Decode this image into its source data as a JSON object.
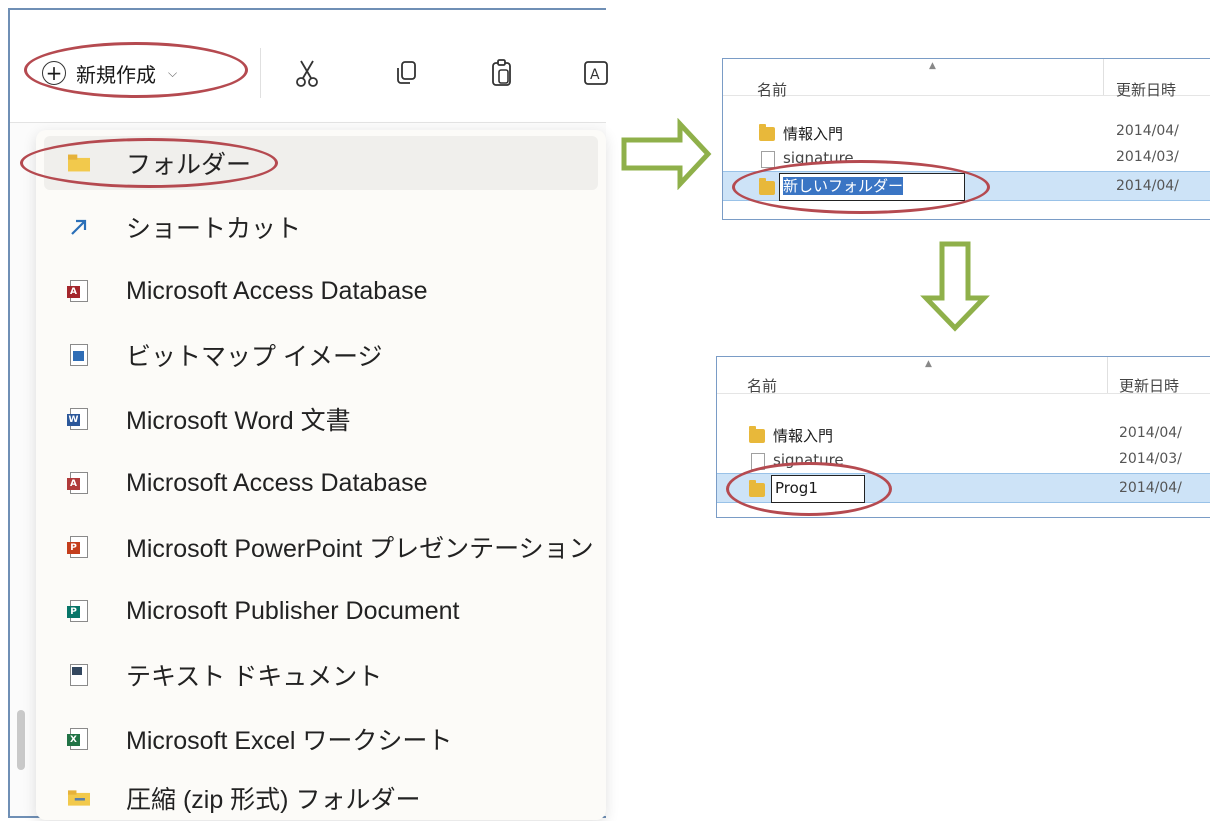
{
  "toolbar": {
    "new_label": "新規作成",
    "icons": [
      "scissors-icon",
      "copy-icon",
      "paste-icon",
      "rename-icon"
    ]
  },
  "menu": {
    "items": [
      {
        "label": "フォルダー",
        "icon": "folder-icon"
      },
      {
        "label": "ショートカット",
        "icon": "shortcut-icon"
      },
      {
        "label": "Microsoft Access Database",
        "icon": "access-icon"
      },
      {
        "label": "ビットマップ イメージ",
        "icon": "bitmap-icon"
      },
      {
        "label": "Microsoft Word 文書",
        "icon": "word-icon"
      },
      {
        "label": "Microsoft Access Database",
        "icon": "access-icon"
      },
      {
        "label": "Microsoft PowerPoint プレゼンテーション",
        "icon": "powerpoint-icon"
      },
      {
        "label": "Microsoft Publisher Document",
        "icon": "publisher-icon"
      },
      {
        "label": "テキスト ドキュメント",
        "icon": "text-document-icon"
      },
      {
        "label": "Microsoft Excel ワークシート",
        "icon": "excel-icon"
      },
      {
        "label": "圧縮 (zip 形式) フォルダー",
        "icon": "zip-folder-icon"
      }
    ]
  },
  "pane_top": {
    "col_name": "名前",
    "col_date": "更新日時",
    "rows": [
      {
        "name": "情報入門",
        "date": "2014/04/"
      },
      {
        "name": "signature",
        "date": "2014/03/"
      },
      {
        "name": "",
        "date": "2014/04/"
      }
    ],
    "edit_value": "新しいフォルダー"
  },
  "pane_bottom": {
    "col_name": "名前",
    "col_date": "更新日時",
    "rows": [
      {
        "name": "情報入門",
        "date": "2014/04/"
      },
      {
        "name": "signature",
        "date": "2014/03/"
      },
      {
        "name": "",
        "date": "2014/04/"
      }
    ],
    "edit_value": "Prog1"
  },
  "colors": {
    "annotation": "#b54a50",
    "arrow": "#8fb04a",
    "selection": "#cde3f7"
  }
}
